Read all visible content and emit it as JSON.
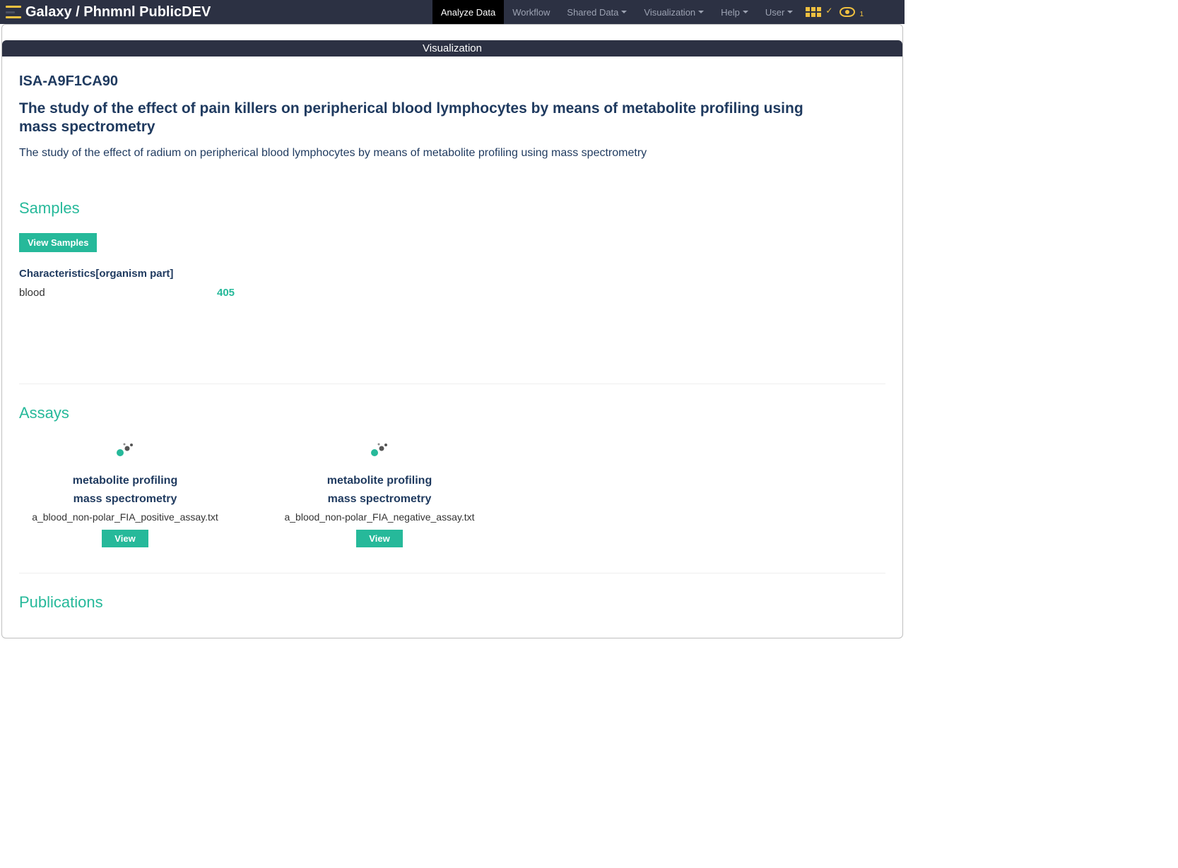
{
  "header": {
    "brand": "Galaxy / Phnmnl PublicDEV",
    "nav": {
      "analyze": "Analyze Data",
      "workflow": "Workflow",
      "shared": "Shared Data",
      "visualization": "Visualization",
      "help": "Help",
      "user": "User"
    },
    "badge_count": "1"
  },
  "panel": {
    "title": "Visualization"
  },
  "study": {
    "id": "ISA-A9F1CA90",
    "title": "The study of the effect of pain killers on peripherical blood lymphocytes by means of metabolite profiling using mass spectrometry",
    "description": "The study of the effect of radium on peripherical blood lymphocytes by means of metabolite profiling using mass spectrometry"
  },
  "samples": {
    "heading": "Samples",
    "view_button": "View Samples",
    "char_label": "Characteristics[organism part]",
    "rows": [
      {
        "name": "blood",
        "count": "405"
      }
    ]
  },
  "assays": {
    "heading": "Assays",
    "view_label": "View",
    "items": [
      {
        "type": "metabolite profiling",
        "tech": "mass spectrometry",
        "file": "a_blood_non-polar_FIA_positive_assay.txt"
      },
      {
        "type": "metabolite profiling",
        "tech": "mass spectrometry",
        "file": "a_blood_non-polar_FIA_negative_assay.txt"
      }
    ]
  },
  "publications": {
    "heading": "Publications"
  }
}
